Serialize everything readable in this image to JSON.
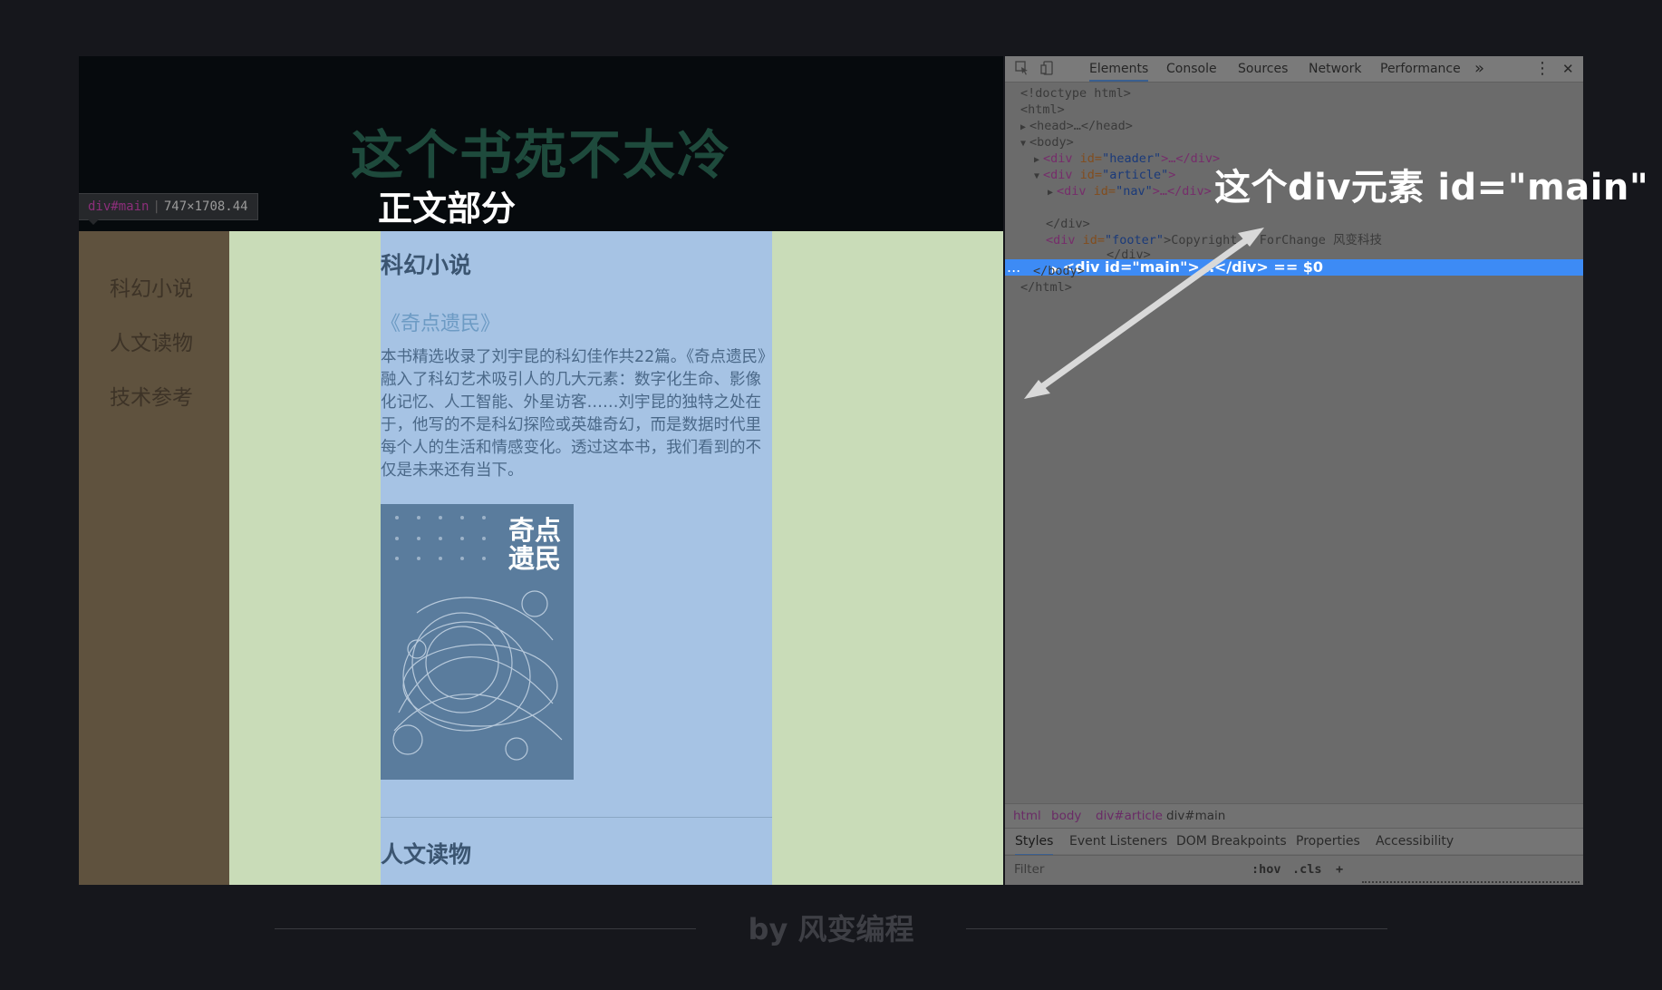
{
  "page": {
    "site_title": "这个书苑不太冷",
    "element_tag": {
      "tag": "div#main",
      "size": "747×1708.44"
    },
    "section_caption": "正文部分",
    "nav": [
      "科幻小说",
      "人文读物",
      "技术参考"
    ],
    "main": {
      "heading": "科幻小说",
      "book_title": "《奇点遗民》",
      "description": "本书精选收录了刘宇昆的科幻佳作共22篇。《奇点遗民》融入了科幻艺术吸引人的几大元素：数字化生命、影像化记忆、人工智能、外星访客……刘宇昆的独特之处在于，他写的不是科幻探险或英雄奇幻，而是数据时代里每个人的生活和情感变化。透过这本书，我们看到的不仅是未来还有当下。",
      "cover_text": [
        "奇点",
        "遗民"
      ],
      "next_heading": "人文读物"
    }
  },
  "devtools": {
    "tabs": [
      "Elements",
      "Console",
      "Sources",
      "Network",
      "Performance"
    ],
    "more_tabs": "»",
    "menu_icon": "⋮",
    "close_icon": "✕",
    "code": {
      "doctype": "<!doctype html>",
      "html_open": "<html>",
      "head": "<head>…</head>",
      "body_open": "<body>",
      "header_div": {
        "tag": "<div ",
        "attr": "id=",
        "val": "\"header\"",
        "rest": ">…</div>"
      },
      "article_div": {
        "tag": "<div ",
        "attr": "id=",
        "val": "\"article\"",
        "rest": ">"
      },
      "nav_div": {
        "tag": "<div ",
        "attr": "id=",
        "val": "\"nav\"",
        "rest": ">…</div>"
      },
      "main_div": "<div id=\"main\">…</div> == $0",
      "main_dots": "...",
      "div_close": "</div>",
      "footer_div": {
        "tag": "<div ",
        "attr": "id=",
        "val": "\"footer\"",
        "rest": ">Copyright © ForChange 风变科技"
      },
      "footer_close": "</div>",
      "body_close": "</body>",
      "html_close": "</html>"
    },
    "callout": "这个div元素 id=\"main\"",
    "breadcrumbs": [
      "html",
      "body",
      "div#article",
      "div#main"
    ],
    "subtabs": [
      "Styles",
      "Event Listeners",
      "DOM Breakpoints",
      "Properties",
      "Accessibility"
    ],
    "filter_placeholder": "Filter",
    "filter_buttons": [
      ":hov",
      ".cls",
      "+"
    ]
  },
  "footer": {
    "by": "by 风变编程"
  }
}
